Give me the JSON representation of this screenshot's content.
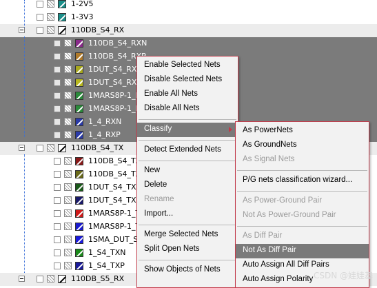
{
  "tree": {
    "rows": [
      {
        "label": "1-2V5",
        "style": "normal",
        "level": 1,
        "color": "#1a8f8a"
      },
      {
        "label": "1-3V3",
        "style": "normal",
        "level": 1,
        "color": "#1a8f8a"
      },
      {
        "label": "110DB_S4_RX",
        "style": "group",
        "level": 0,
        "color": "outline"
      },
      {
        "label": "110DB_S4_RXN",
        "style": "dark",
        "level": 2,
        "color": "#8a2a8a"
      },
      {
        "label": "110DB_S4_RXP",
        "style": "dark",
        "level": 2,
        "color": "#b07a2a"
      },
      {
        "label": "1DUT_S4_RXN",
        "style": "dark",
        "level": 2,
        "color": "#a8a81e"
      },
      {
        "label": "1DUT_S4_RXP",
        "style": "dark",
        "level": 2,
        "color": "#b8b81e"
      },
      {
        "label": "1MARS8P-1_RXN",
        "style": "dark",
        "level": 2,
        "color": "#2a8a3a"
      },
      {
        "label": "1MARS8P-1_RXP",
        "style": "dark",
        "level": 2,
        "color": "#2a8a3a"
      },
      {
        "label": "1_4_RXN",
        "style": "dark",
        "level": 2,
        "color": "#2a3aa8"
      },
      {
        "label": "1_4_RXP",
        "style": "dark",
        "level": 2,
        "color": "#2a3aa8"
      },
      {
        "label": "110DB_S4_TX",
        "style": "group",
        "level": 0,
        "color": "outline"
      },
      {
        "label": "110DB_S4_TXN",
        "style": "normal",
        "level": 2,
        "color": "#8a1a1a"
      },
      {
        "label": "110DB_S4_TXP",
        "style": "normal",
        "level": 2,
        "color": "#6a6a1a"
      },
      {
        "label": "1DUT_S4_TXN",
        "style": "normal",
        "level": 2,
        "color": "#1a5a1a"
      },
      {
        "label": "1DUT_S4_TXP",
        "style": "normal",
        "level": 2,
        "color": "#1a1a6a"
      },
      {
        "label": "1MARS8P-1_TXN",
        "style": "normal",
        "level": 2,
        "color": "#d01a1a"
      },
      {
        "label": "1MARS8P-1_TXP",
        "style": "normal",
        "level": 2,
        "color": "#1a1ad0"
      },
      {
        "label": "1SMA_DUT_S4_TX",
        "style": "normal",
        "level": 2,
        "color": "#1a1ae0"
      },
      {
        "label": "1_S4_TXN",
        "style": "normal",
        "level": 2,
        "color": "#1a8a1a"
      },
      {
        "label": "1_S4_TXP",
        "style": "normal",
        "level": 2,
        "color": "#1a1a9a"
      },
      {
        "label": "110DB_S5_RX",
        "style": "group",
        "level": 0,
        "color": "outline"
      }
    ]
  },
  "context_menu": {
    "items": [
      {
        "label": "Enable Selected Nets",
        "state": "normal"
      },
      {
        "label": "Disable Selected Nets",
        "state": "normal"
      },
      {
        "label": "Enable All Nets",
        "state": "normal"
      },
      {
        "label": "Disable All Nets",
        "state": "normal"
      },
      {
        "sep": true
      },
      {
        "label": "Classify",
        "state": "highlight",
        "submenu": true
      },
      {
        "sep": true
      },
      {
        "label": "Detect Extended Nets",
        "state": "normal"
      },
      {
        "sep": true
      },
      {
        "label": "New",
        "state": "normal"
      },
      {
        "label": "Delete",
        "state": "normal"
      },
      {
        "label": "Rename",
        "state": "disabled"
      },
      {
        "label": "Import...",
        "state": "normal"
      },
      {
        "sep": true
      },
      {
        "label": "Merge Selected Nets",
        "state": "normal"
      },
      {
        "label": "Split Open Nets",
        "state": "normal"
      },
      {
        "sep": true
      },
      {
        "label": "Show Objects of Nets",
        "state": "normal"
      }
    ]
  },
  "classify_submenu": {
    "items": [
      {
        "label": "As PowerNets",
        "state": "normal"
      },
      {
        "label": "As GroundNets",
        "state": "normal"
      },
      {
        "label": "As Signal Nets",
        "state": "disabled"
      },
      {
        "sep": true
      },
      {
        "label": "P/G nets classification wizard...",
        "state": "normal"
      },
      {
        "sep": true
      },
      {
        "label": "As Power-Ground Pair",
        "state": "disabled"
      },
      {
        "label": "Not As Power-Ground Pair",
        "state": "disabled"
      },
      {
        "sep": true
      },
      {
        "label": "As Diff Pair",
        "state": "disabled"
      },
      {
        "label": "Not As Diff Pair",
        "state": "highlight"
      },
      {
        "label": "Auto Assign All Diff Pairs",
        "state": "normal"
      },
      {
        "label": "Auto Assign Polarity",
        "state": "normal"
      }
    ]
  },
  "watermark": "CSDN @娃娃基"
}
